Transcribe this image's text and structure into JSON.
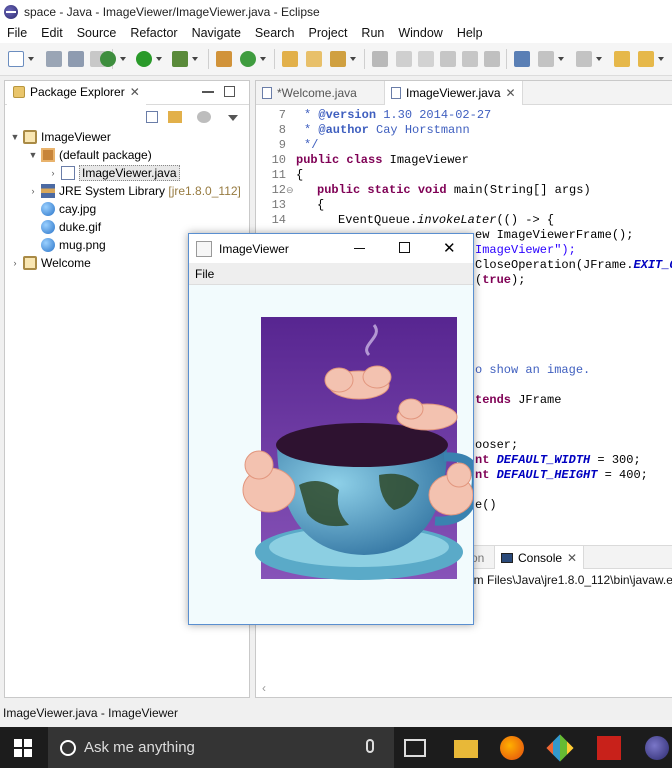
{
  "window": {
    "title": "space - Java - ImageViewer/ImageViewer.java - Eclipse"
  },
  "menubar": [
    "File",
    "Edit",
    "Source",
    "Refactor",
    "Navigate",
    "Search",
    "Project",
    "Run",
    "Window",
    "Help"
  ],
  "package_explorer": {
    "tab_label": "Package Explorer",
    "tree": {
      "project": "ImageViewer",
      "package": "(default package)",
      "java_file": "ImageViewer.java",
      "jre_label": "JRE System Library",
      "jre_version": "[jre1.8.0_112]",
      "files": [
        "cay.jpg",
        "duke.gif",
        "mug.png"
      ],
      "welcome": "Welcome"
    }
  },
  "editor": {
    "tabs": [
      {
        "label": "*Welcome.java",
        "active": false
      },
      {
        "label": "ImageViewer.java",
        "active": true
      }
    ],
    "line_numbers": [
      "7",
      "8",
      "9",
      "10",
      "11",
      "12",
      "13",
      "14"
    ],
    "code": {
      "l7_tag": "@version",
      "l7_rest": " 1.30 2014-02-27",
      "l8_tag": "@author",
      "l8_rest": " Cay Horstmann",
      "l9": "*/",
      "l10_kw": "public class",
      "l10_rest": " ImageViewer",
      "l11": "{",
      "l12_kw": "public static void",
      "l12_rest": " main(String[] args)",
      "l13": "{",
      "l14_a": "EventQueue.",
      "l14_b": "invokeLater",
      "l14_c": "(() -> {",
      "r1": "ew ImageViewerFrame();",
      "r2": "ImageViewer\");",
      "r3_a": "CloseOperation(JFrame.",
      "r3_b": "EXIT_ON",
      "r4_a": "(",
      "r4_b": "true",
      "r4_c": ");",
      "r5": "o show an image.",
      "r6_kw": "tends",
      "r6_rest": " JFrame",
      "r7": "ooser;",
      "r8_kw": "nt",
      "r8_f": "DEFAULT_WIDTH",
      "r8_v": " = 300;",
      "r9_kw": "nt",
      "r9_f": "DEFAULT_HEIGHT",
      "r9_v": " = 400;",
      "r10": "e()"
    }
  },
  "console": {
    "tab_prefix": "on",
    "tab_label": "Console",
    "text": "am Files\\Java\\jre1.8.0_112\\bin\\javaw.e"
  },
  "image_viewer_window": {
    "title": "ImageViewer",
    "menu": "File"
  },
  "statusbar": {
    "text": "ImageViewer.java - ImageViewer"
  },
  "taskbar": {
    "search_placeholder": "Ask me anything"
  }
}
